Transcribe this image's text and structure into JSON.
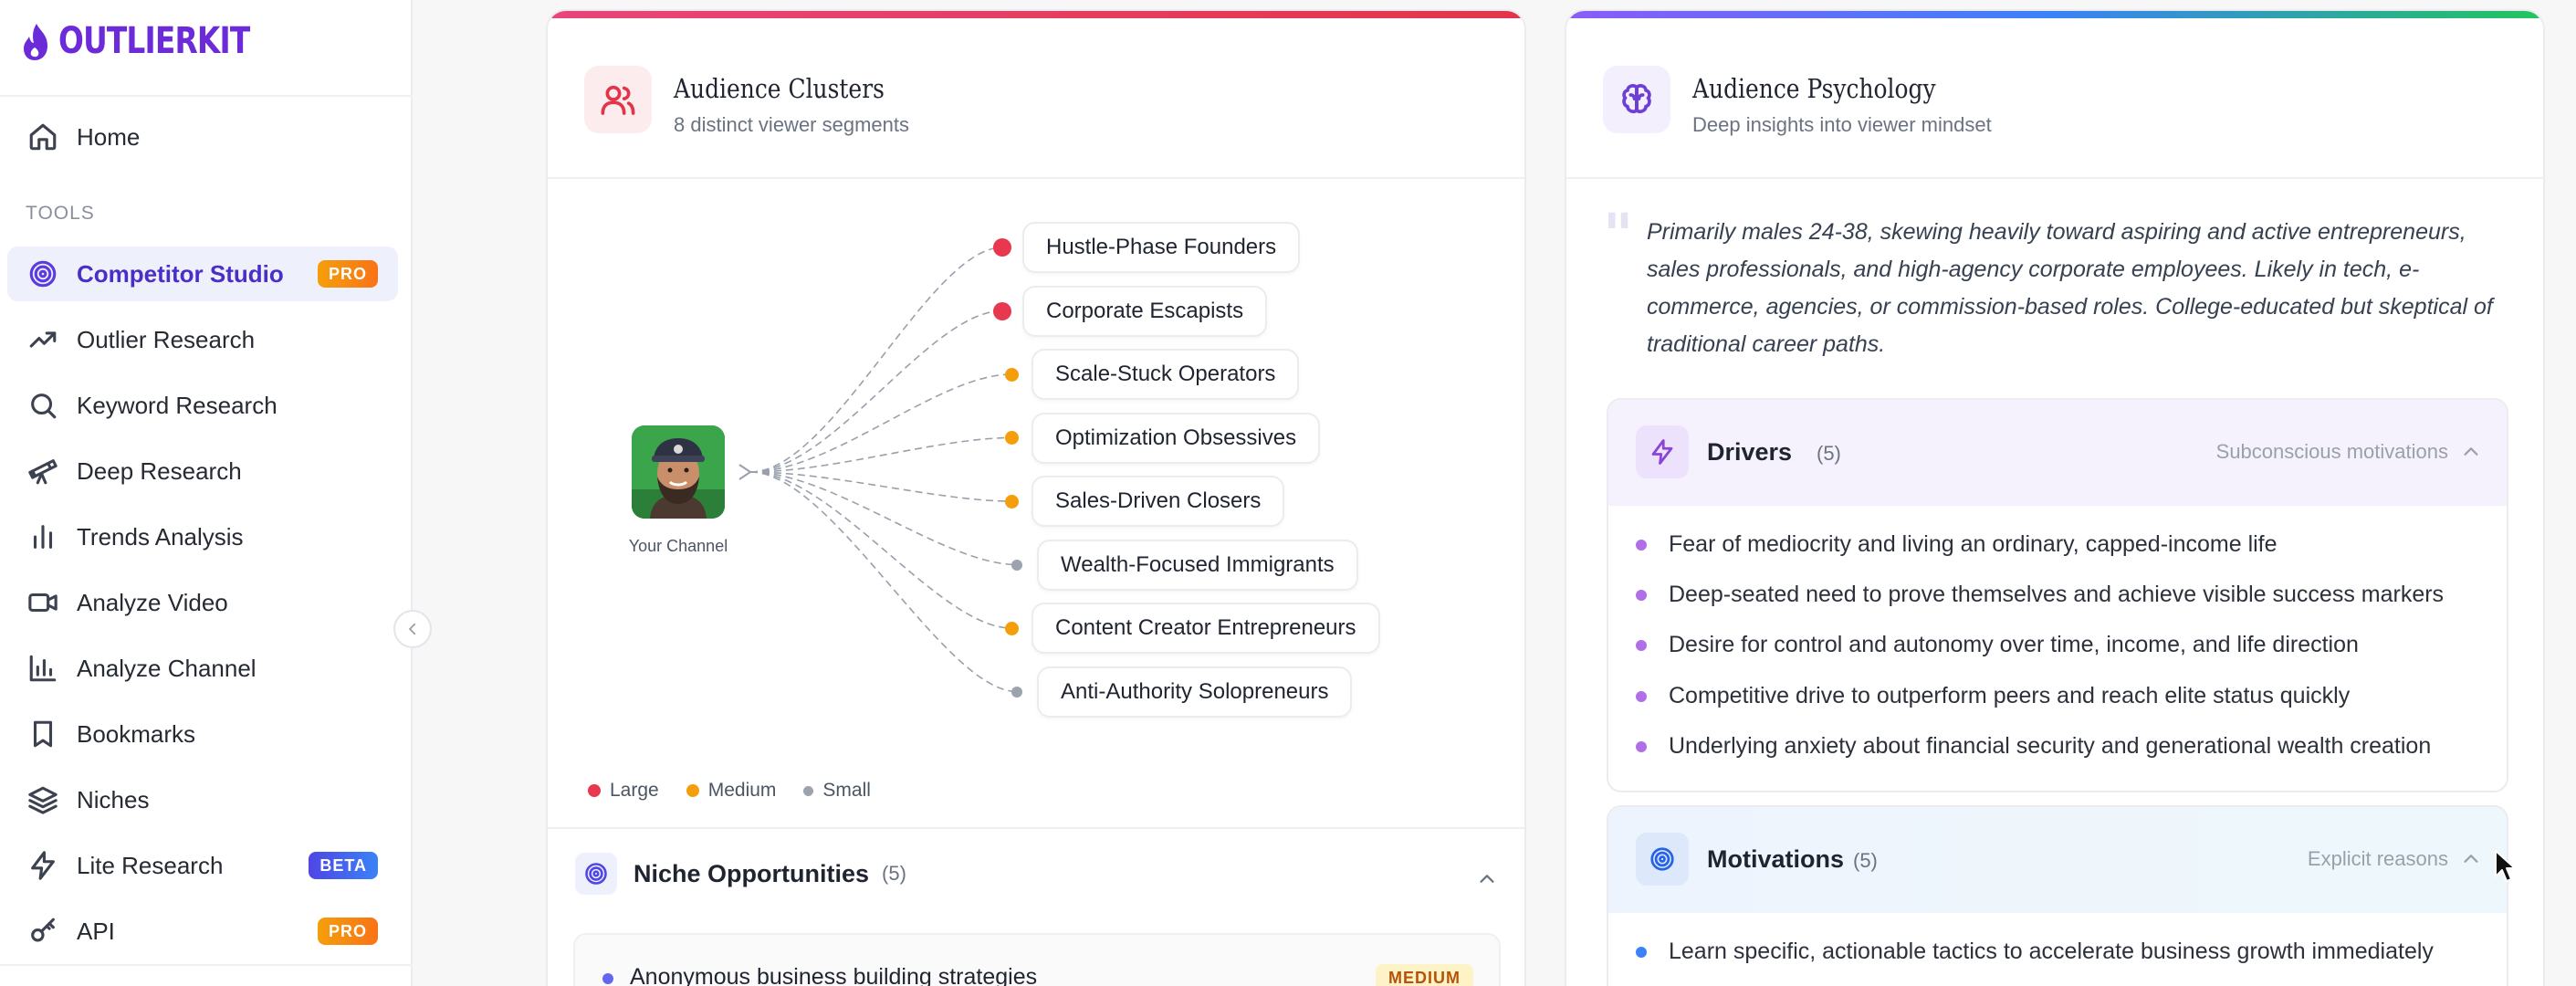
{
  "app": {
    "logo_text": "OUTLIERKIT",
    "brand_color": "#6c2bd9"
  },
  "sidebar": {
    "section_label": "TOOLS",
    "home": {
      "label": "Home",
      "icon": "home-icon"
    },
    "items": [
      {
        "label": "Competitor Studio",
        "icon": "target-icon",
        "active": true,
        "badge": "PRO"
      },
      {
        "label": "Outlier Research",
        "icon": "trending-up-icon"
      },
      {
        "label": "Keyword Research",
        "icon": "search-icon"
      },
      {
        "label": "Deep Research",
        "icon": "telescope-icon"
      },
      {
        "label": "Trends Analysis",
        "icon": "bar-chart-icon"
      },
      {
        "label": "Analyze Video",
        "icon": "video-icon"
      },
      {
        "label": "Analyze Channel",
        "icon": "channel-chart-icon"
      },
      {
        "label": "Bookmarks",
        "icon": "bookmark-icon"
      },
      {
        "label": "Niches",
        "icon": "layers-icon"
      },
      {
        "label": "Lite Research",
        "icon": "zap-icon",
        "badge": "BETA"
      },
      {
        "label": "API",
        "icon": "key-icon",
        "badge": "PRO"
      }
    ]
  },
  "clusters": {
    "title": "Audience Clusters",
    "subtitle": "8 distinct viewer segments",
    "channel_label": "Your Channel",
    "segments": [
      {
        "label": "Hustle-Phase Founders",
        "size": "Large"
      },
      {
        "label": "Corporate Escapists",
        "size": "Large"
      },
      {
        "label": "Scale-Stuck Operators",
        "size": "Medium"
      },
      {
        "label": "Optimization Obsessives",
        "size": "Medium"
      },
      {
        "label": "Sales-Driven Closers",
        "size": "Medium"
      },
      {
        "label": "Wealth-Focused Immigrants",
        "size": "Small"
      },
      {
        "label": "Content Creator Entrepreneurs",
        "size": "Medium"
      },
      {
        "label": "Anti-Authority Solopreneurs",
        "size": "Small"
      }
    ],
    "legend": {
      "large": "Large",
      "medium": "Medium",
      "small": "Small"
    },
    "size_colors": {
      "Large": "#e8384f",
      "Medium": "#f59e0b",
      "Small": "#9ca3af"
    }
  },
  "niche": {
    "title": "Niche Opportunities",
    "count": "(5)",
    "first_item": "Anonymous business building strategies",
    "first_level": "MEDIUM"
  },
  "psychology": {
    "title": "Audience Psychology",
    "subtitle": "Deep insights into viewer mindset",
    "quote": "Primarily males 24-38, skewing heavily toward aspiring and active entrepreneurs, sales professionals, and high-agency corporate employees. Likely in tech, e-commerce, agencies, or commission-based roles. College-educated but skeptical of traditional career paths.",
    "drivers": {
      "title": "Drivers",
      "count": "(5)",
      "hint": "Subconscious motivations",
      "items": [
        "Fear of mediocrity and living an ordinary, capped-income life",
        "Deep-seated need to prove themselves and achieve visible success markers",
        "Desire for control and autonomy over time, income, and life direction",
        "Competitive drive to outperform peers and reach elite status quickly",
        "Underlying anxiety about financial security and generational wealth creation"
      ]
    },
    "motivations": {
      "title": "Motivations",
      "count": "(5)",
      "hint": "Explicit reasons",
      "items": [
        "Learn specific, actionable tactics to accelerate business growth immediately"
      ]
    }
  }
}
